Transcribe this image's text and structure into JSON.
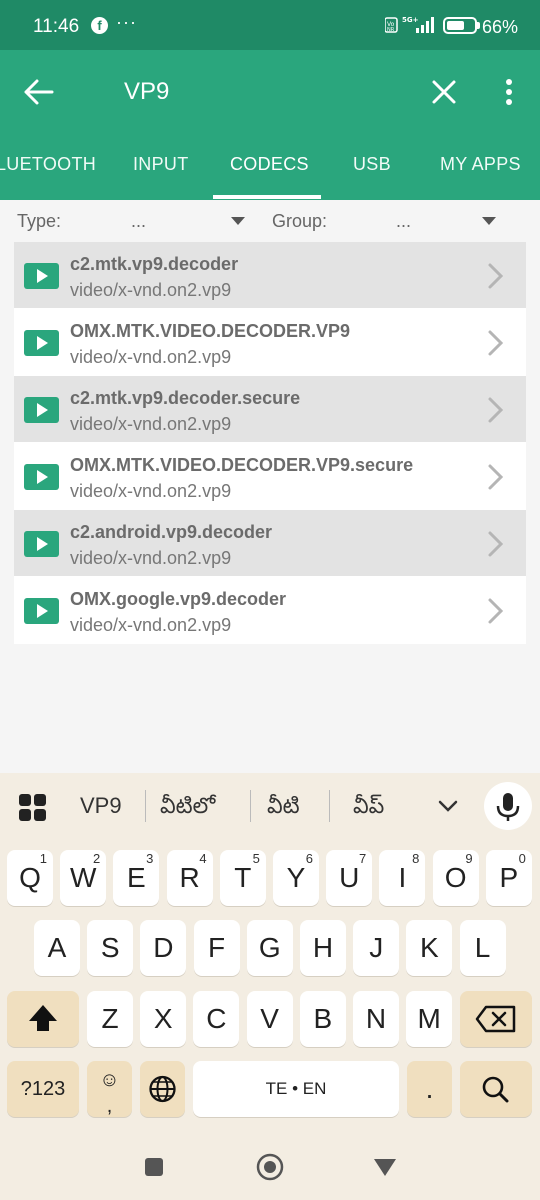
{
  "status": {
    "time": "11:46",
    "facebook_glyph": "f",
    "more_dots": "···",
    "battery": "66%"
  },
  "appbar": {
    "query": "VP9"
  },
  "tabs": [
    {
      "label": "LUETOOTH"
    },
    {
      "label": "INPUT"
    },
    {
      "label": "CODECS"
    },
    {
      "label": "USB"
    },
    {
      "label": "MY APPS"
    }
  ],
  "filter": {
    "type_label": "Type:",
    "type_value": "...",
    "group_label": "Group:",
    "group_value": "..."
  },
  "codecs": [
    {
      "name": "c2.mtk.vp9.decoder",
      "mime": "video/x-vnd.on2.vp9"
    },
    {
      "name": "OMX.MTK.VIDEO.DECODER.VP9",
      "mime": "video/x-vnd.on2.vp9"
    },
    {
      "name": "c2.mtk.vp9.decoder.secure",
      "mime": "video/x-vnd.on2.vp9"
    },
    {
      "name": "OMX.MTK.VIDEO.DECODER.VP9.secure",
      "mime": "video/x-vnd.on2.vp9"
    },
    {
      "name": "c2.android.vp9.decoder",
      "mime": "video/x-vnd.on2.vp9"
    },
    {
      "name": "OMX.google.vp9.decoder",
      "mime": "video/x-vnd.on2.vp9"
    }
  ],
  "keyboard": {
    "suggestions": [
      "VP9",
      "వీటిలో",
      "వీటి",
      "వీప్"
    ],
    "row1": [
      {
        "k": "Q",
        "h": "1"
      },
      {
        "k": "W",
        "h": "2"
      },
      {
        "k": "E",
        "h": "3"
      },
      {
        "k": "R",
        "h": "4"
      },
      {
        "k": "T",
        "h": "5"
      },
      {
        "k": "Y",
        "h": "6"
      },
      {
        "k": "U",
        "h": "7"
      },
      {
        "k": "I",
        "h": "8"
      },
      {
        "k": "O",
        "h": "9"
      },
      {
        "k": "P",
        "h": "0"
      }
    ],
    "row2": [
      "A",
      "S",
      "D",
      "F",
      "G",
      "H",
      "J",
      "K",
      "L"
    ],
    "row3": [
      "Z",
      "X",
      "C",
      "V",
      "B",
      "N",
      "M"
    ],
    "symbols_label": "?123",
    "emoji_label": "☺",
    "comma_label": ",",
    "space_label": "TE • EN",
    "period_label": "."
  },
  "colors": {
    "status_bar": "#1f8a66",
    "app_bar": "#2aa67d",
    "accent": "#2aa67d"
  }
}
